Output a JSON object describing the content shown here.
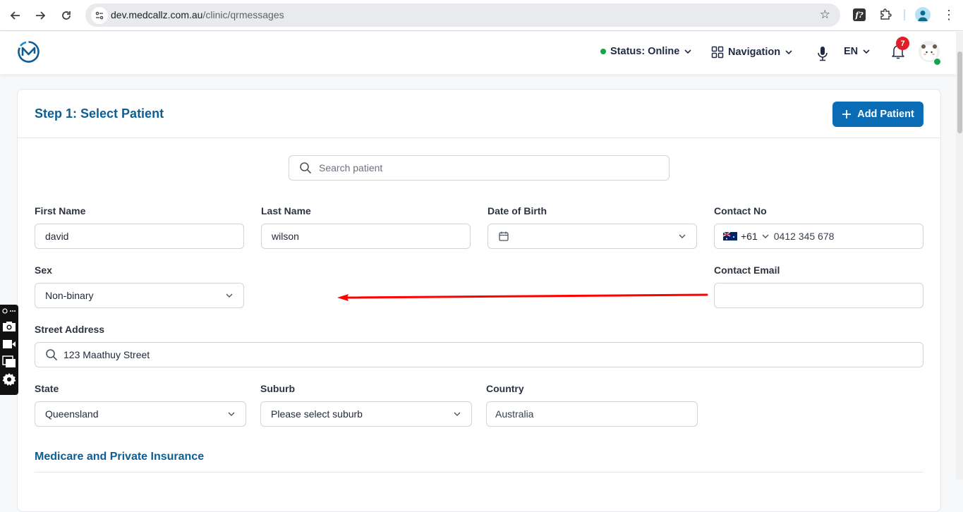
{
  "browser": {
    "url_host": "dev.medcallz.com.au",
    "url_path": "/clinic/qrmessages",
    "icons": [
      "back-icon",
      "forward-icon",
      "reload-icon",
      "site-settings-icon",
      "bookmark-star-icon",
      "extension-f-icon",
      "extensions-puzzle-icon",
      "profile-icon",
      "menu-kebab-icon"
    ],
    "extension_f_label": "f?"
  },
  "header": {
    "status_label": "Status: Online",
    "status_color": "#16a34a",
    "navigation_label": "Navigation",
    "language_label": "EN",
    "notification_count": "7"
  },
  "card": {
    "title": "Step 1: Select Patient",
    "add_patient_label": "Add Patient",
    "search_placeholder": "Search patient"
  },
  "form": {
    "first_name": {
      "label": "First Name",
      "value": "david"
    },
    "last_name": {
      "label": "Last Name",
      "value": "wilson"
    },
    "dob": {
      "label": "Date of Birth",
      "value": ""
    },
    "contact_no": {
      "label": "Contact No",
      "country_code": "+61",
      "value": "0412 345 678"
    },
    "sex": {
      "label": "Sex",
      "value": "Non-binary"
    },
    "contact_email": {
      "label": "Contact Email",
      "value": ""
    },
    "street_address": {
      "label": "Street Address",
      "value": "123 Maathuy Street"
    },
    "state": {
      "label": "State",
      "value": "Queensland"
    },
    "suburb": {
      "label": "Suburb",
      "value": "Please select suburb"
    },
    "country": {
      "label": "Country",
      "value": "Australia"
    }
  },
  "sections": {
    "medicare_title": "Medicare and Private Insurance"
  },
  "colors": {
    "brand": "#0a6cb5",
    "title": "#0d5e94",
    "annotation_arrow": "#ff0000",
    "badge": "#e11d27"
  }
}
